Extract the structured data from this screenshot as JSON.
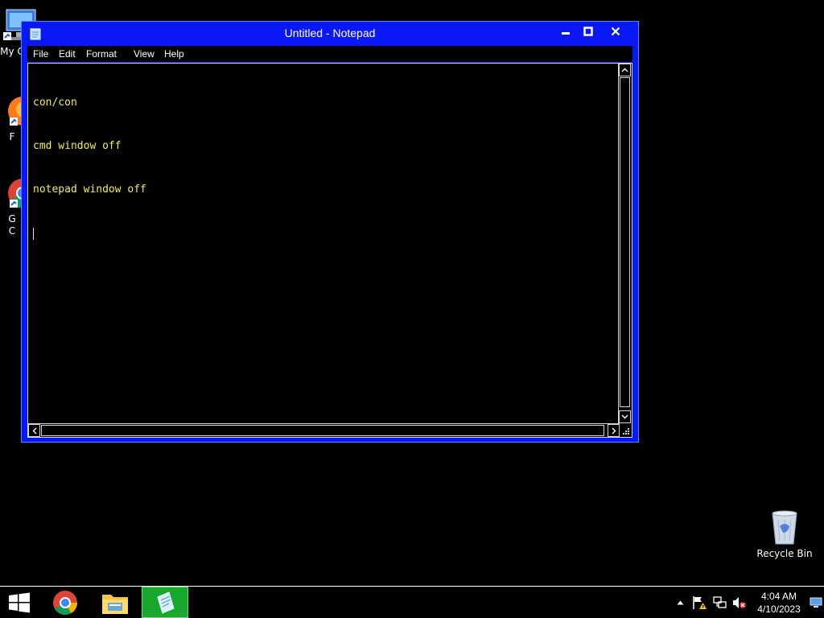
{
  "desktop": {
    "icons": [
      {
        "label": "My C",
        "icon": "computer-icon"
      },
      {
        "label": "F",
        "icon": "firefox-icon"
      },
      {
        "label": "G\nC",
        "icon": "chrome-icon"
      },
      {
        "label": "Recycle Bin",
        "icon": "recycle-bin-icon"
      }
    ]
  },
  "window": {
    "title": "Untitled - Notepad",
    "app_icon": "notepad-icon",
    "controls": {
      "minimize": "minimize-icon",
      "maximize": "maximize-icon",
      "close": "close-icon"
    },
    "menu": [
      "File",
      "Edit",
      "Format",
      "View",
      "Help"
    ],
    "content_lines": [
      "con/con",
      "cmd window off",
      "notepad window off"
    ],
    "colors": {
      "titlebar": "#0a18f5",
      "text": "#f4f03c",
      "background": "#000000"
    }
  },
  "taskbar": {
    "apps": [
      {
        "name": "start",
        "icon": "windows-logo-icon"
      },
      {
        "name": "chrome",
        "icon": "chrome-icon"
      },
      {
        "name": "explorer",
        "icon": "file-explorer-icon"
      },
      {
        "name": "notepad",
        "icon": "notepad-icon",
        "active": true
      }
    ],
    "tray_icons": [
      "show-hidden-icons-chevron-icon",
      "action-center-flag-icon",
      "network-icon",
      "volume-muted-icon"
    ],
    "time": "4:04 AM",
    "date": "4/10/2023",
    "active_color": "#18a82e"
  }
}
